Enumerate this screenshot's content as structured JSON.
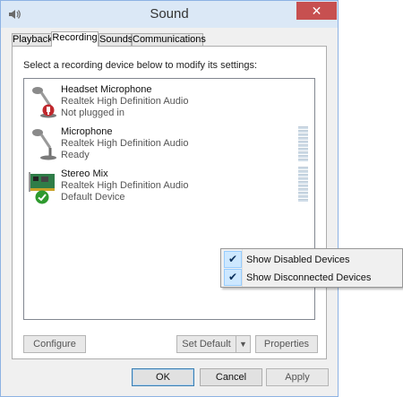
{
  "window": {
    "title": "Sound",
    "close_label": "✕"
  },
  "tabs": [
    {
      "label": "Playback",
      "active": false
    },
    {
      "label": "Recording",
      "active": true
    },
    {
      "label": "Sounds",
      "active": false
    },
    {
      "label": "Communications",
      "active": false
    }
  ],
  "panel": {
    "instruction": "Select a recording device below to modify its settings:"
  },
  "devices": [
    {
      "name": "Headset Microphone",
      "driver": "Realtek High Definition Audio",
      "status": "Not plugged in",
      "icon": "microphone-icon",
      "badge": "unplugged-badge-icon",
      "badge_color": "#c0282d"
    },
    {
      "name": "Microphone",
      "driver": "Realtek High Definition Audio",
      "status": "Ready",
      "icon": "microphone-icon"
    },
    {
      "name": "Stereo Mix",
      "driver": "Realtek High Definition Audio",
      "status": "Default Device",
      "icon": "sound-card-icon",
      "badge": "default-check-badge-icon",
      "badge_color": "#2e9a2e"
    }
  ],
  "buttons": {
    "configure": "Configure",
    "set_default": "Set Default",
    "dropdown_arrow": "▼",
    "properties": "Properties",
    "ok": "OK",
    "cancel": "Cancel",
    "apply": "Apply"
  },
  "context_menu": {
    "items": [
      {
        "label": "Show Disabled Devices",
        "checked": true,
        "check": "✔"
      },
      {
        "label": "Show Disconnected Devices",
        "checked": true,
        "check": "✔"
      }
    ]
  },
  "colors": {
    "titlebar": "#dbe8f6",
    "close_button": "#c75050",
    "check_highlight": "#cde8ff"
  }
}
